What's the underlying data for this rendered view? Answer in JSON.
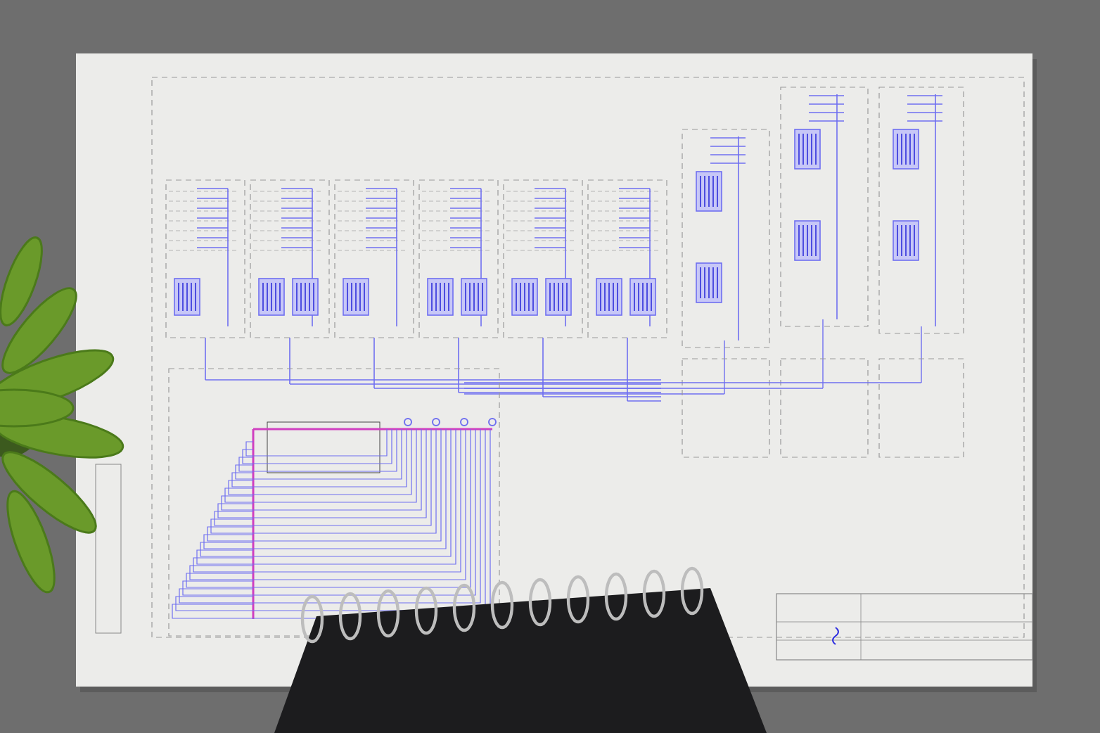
{
  "drawing_sheet": {
    "kind": "schematic"
  }
}
